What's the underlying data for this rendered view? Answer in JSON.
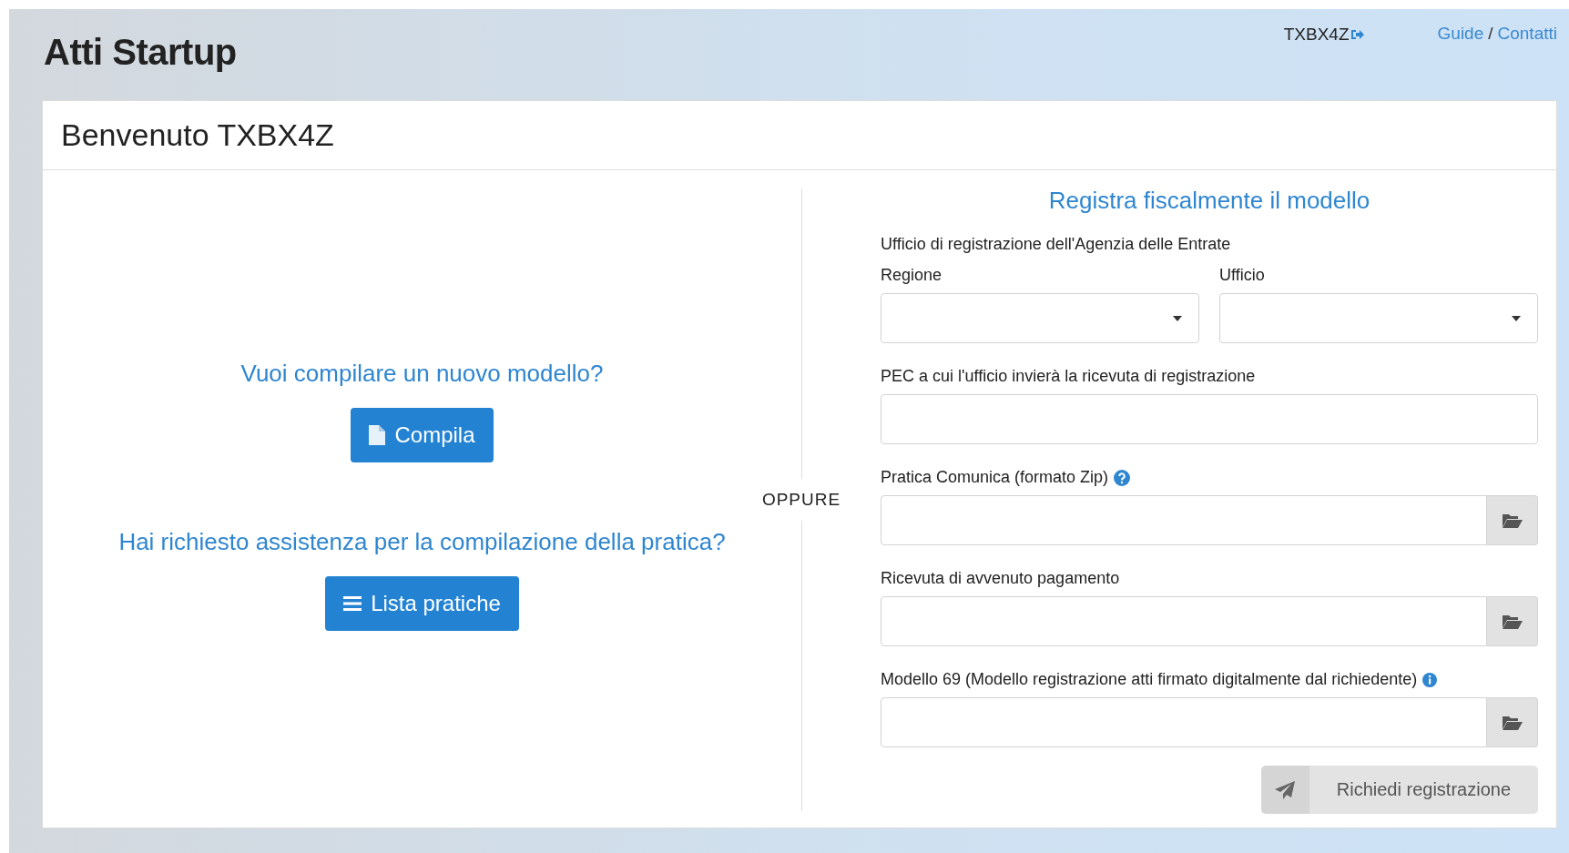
{
  "header": {
    "title": "Atti Startup",
    "user": "TXBX4Z",
    "links": [
      {
        "label": "Guide"
      },
      {
        "label": "Contatti"
      }
    ],
    "separator": "/"
  },
  "card": {
    "title": "Benvenuto TXBX4Z"
  },
  "left": {
    "sections": [
      {
        "question": "Vuoi compilare un nuovo modello?",
        "button": "Compila",
        "kind": "new"
      },
      {
        "question": "Hai richiesto assistenza per la compilazione della pratica?",
        "button": "Lista pratiche",
        "kind": "list"
      }
    ]
  },
  "divider_label": "OPPURE",
  "form": {
    "title": "Registra fiscalmente il modello",
    "group_label": "Ufficio di registrazione dell'Agenzia delle Entrate",
    "selects": [
      {
        "label": "Regione"
      },
      {
        "label": "Ufficio"
      }
    ],
    "fields": [
      {
        "kind": "text",
        "label": "PEC a cui l'ufficio invierà la ricevuta di registrazione"
      },
      {
        "kind": "file",
        "label": "Pratica Comunica (formato Zip)",
        "help": {
          "kind": "question"
        }
      },
      {
        "kind": "file",
        "label": "Ricevuta di avvenuto pagamento"
      },
      {
        "kind": "file",
        "label": "Modello 69 (Modello registrazione atti firmato digitalmente dal richiedente)",
        "help": {
          "kind": "info"
        }
      }
    ],
    "submit": {
      "label": "Richiedi registrazione",
      "disabled": true
    }
  }
}
